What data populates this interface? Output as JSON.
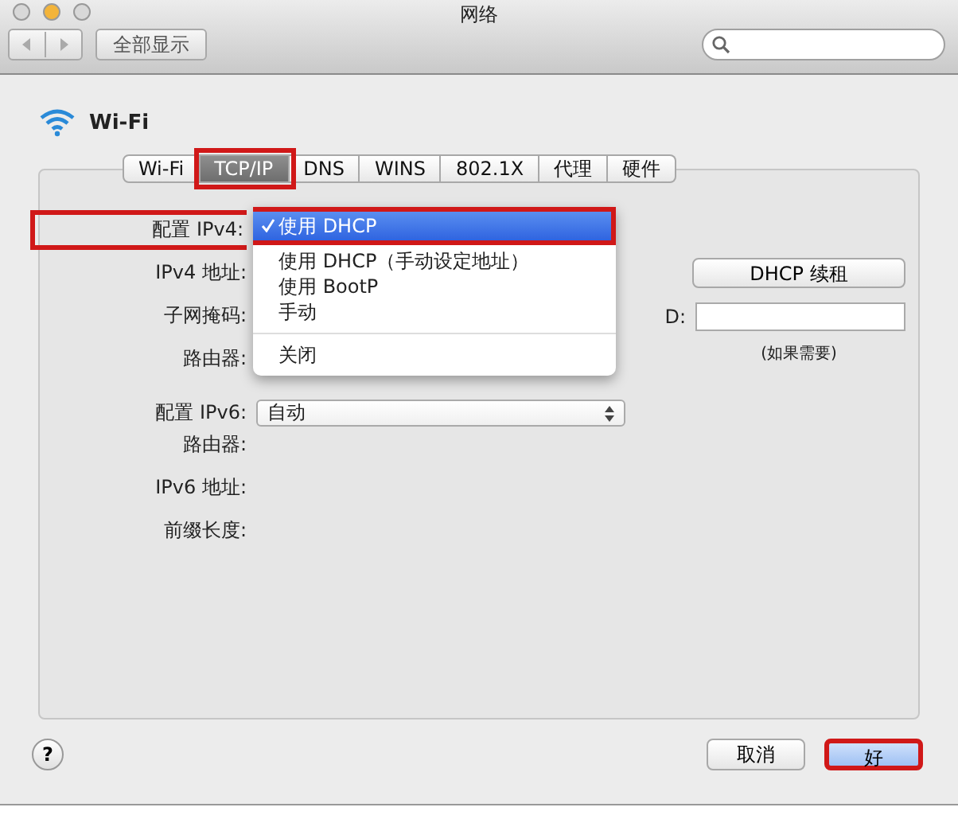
{
  "window": {
    "title": "网络"
  },
  "toolbar": {
    "show_all_button": "全部显示"
  },
  "service": {
    "name": "Wi-Fi"
  },
  "tabs": [
    {
      "label": "Wi-Fi",
      "selected": false
    },
    {
      "label": "TCP/IP",
      "selected": true
    },
    {
      "label": "DNS",
      "selected": false
    },
    {
      "label": "WINS",
      "selected": false
    },
    {
      "label": "802.1X",
      "selected": false
    },
    {
      "label": "代理",
      "selected": false
    },
    {
      "label": "硬件",
      "selected": false
    }
  ],
  "ipv4": {
    "label": "配置 IPv4:",
    "menu": [
      {
        "label": "使用 DHCP",
        "selected": true,
        "separator_before": false
      },
      {
        "label": "使用 DHCP（手动设定地址）",
        "selected": false,
        "separator_before": false
      },
      {
        "label": "使用 BootP",
        "selected": false,
        "separator_before": false
      },
      {
        "label": "手动",
        "selected": false,
        "separator_before": false
      },
      {
        "label": "关闭",
        "selected": false,
        "separator_before": true
      }
    ]
  },
  "ipv4_fields": [
    {
      "label": "IPv4 地址:"
    },
    {
      "label": "子网掩码:"
    },
    {
      "label": "路由器:"
    }
  ],
  "dhcp_renew_button": "DHCP 续租",
  "client_id": {
    "label": "D:",
    "hint": "(如果需要)"
  },
  "ipv6": {
    "label": "配置 IPv6:",
    "value": "自动"
  },
  "ipv6_fields": [
    {
      "label": "路由器:"
    },
    {
      "label": "IPv6 地址:"
    },
    {
      "label": "前缀长度:"
    }
  ],
  "help_button": "?",
  "buttons": [
    {
      "label": "取消",
      "highlighted": false
    },
    {
      "label": "好",
      "highlighted": true
    }
  ]
}
